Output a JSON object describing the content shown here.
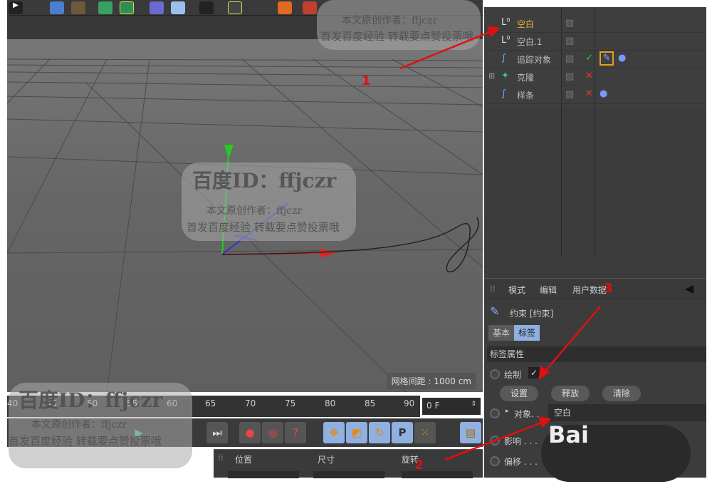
{
  "object_manager": {
    "objects": [
      {
        "name": "空白",
        "selected": true,
        "icon": "null-object-icon"
      },
      {
        "name": "空白.1",
        "icon": "null-object-icon"
      },
      {
        "name": "追踪对象",
        "icon": "spline-icon",
        "status": "check"
      },
      {
        "name": "克隆",
        "icon": "cloner-icon",
        "status": "x",
        "expandable": true
      },
      {
        "name": "样条",
        "icon": "spline-icon",
        "status": "x"
      }
    ]
  },
  "attributes": {
    "menu": [
      "模式",
      "编辑",
      "用户数据"
    ],
    "tag_title": "约束 [约束]",
    "tabs": [
      "基本",
      "标签"
    ],
    "active_tab": "标签",
    "section": "标签属性",
    "draw_label": "绘制",
    "draw_checked": true,
    "buttons": [
      "设置",
      "释放",
      "清除"
    ],
    "target_label": "对象. .",
    "target_value": "空白",
    "influence_label": "影响 . . .",
    "offset_label": "偏移 . . ."
  },
  "viewport": {
    "grid_spacing": "网格间距 : 1000 cm"
  },
  "timeline": {
    "ticks": [
      "40",
      "45",
      "50",
      "55",
      "60",
      "65",
      "70",
      "75",
      "80",
      "85",
      "90"
    ],
    "frame": "0 F"
  },
  "coordinates": {
    "headers": [
      "位置",
      "尺寸",
      "旋转"
    ]
  },
  "annotations": [
    "1",
    "2",
    "3"
  ],
  "watermark": {
    "id": "百度ID：ffjczr",
    "author": "本文原创作者：ffjczr",
    "note": "首发百度经验 转载要点赞投票哦",
    "logo": "Bai"
  },
  "colors": {
    "accent": "#8fb0e0",
    "selected": "#e0b030",
    "arrow": "#e01010"
  }
}
